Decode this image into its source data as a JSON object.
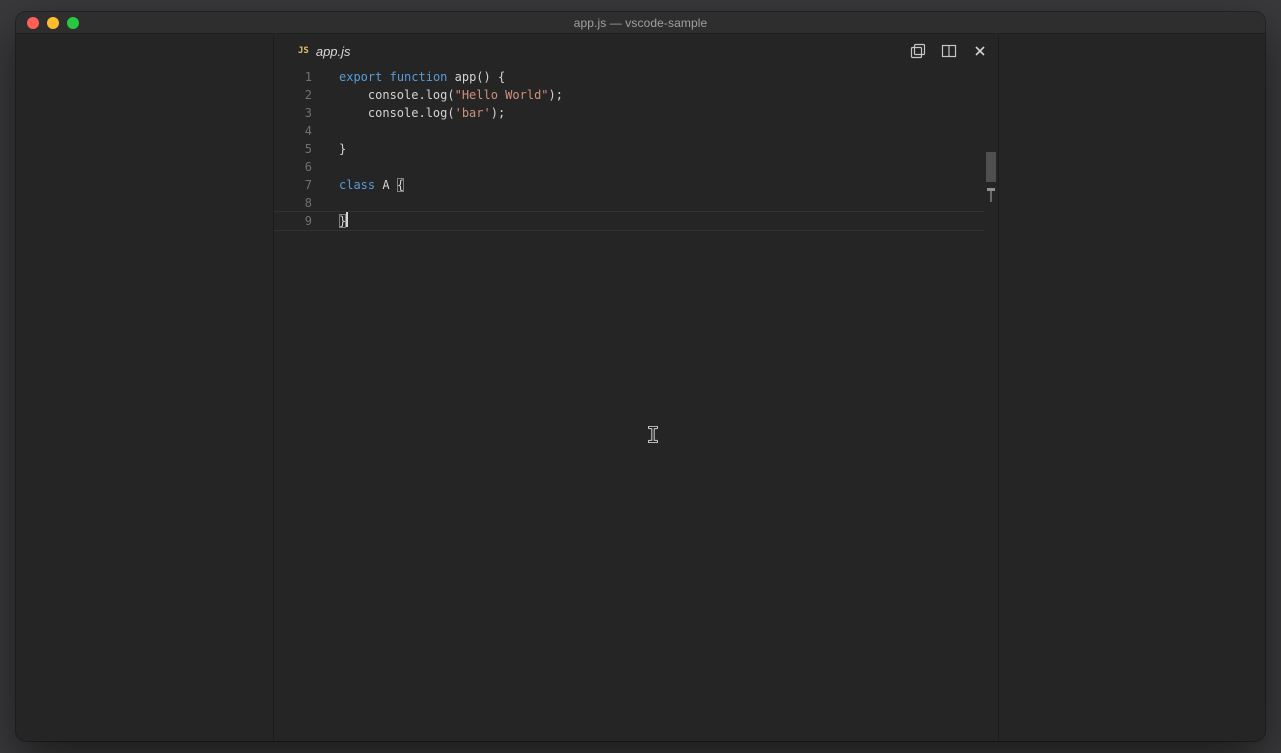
{
  "window": {
    "title": "app.js — vscode-sample"
  },
  "titlebar": {
    "buttons": [
      "close-window",
      "minimize-window",
      "zoom-window"
    ]
  },
  "tab": {
    "file_type_badge": "JS",
    "label": "app.js",
    "is_preview_italic": true
  },
  "editor_actions": [
    {
      "name": "open-changes-icon"
    },
    {
      "name": "split-editor-icon"
    },
    {
      "name": "close-editor-icon"
    }
  ],
  "code": {
    "language": "javascript",
    "lines": [
      {
        "number": "1",
        "segments": [
          {
            "t": "export",
            "c": "kw"
          },
          {
            "t": " ",
            "c": "pl"
          },
          {
            "t": "function",
            "c": "kw"
          },
          {
            "t": " app() {",
            "c": "pl"
          }
        ]
      },
      {
        "number": "2",
        "segments": [
          {
            "t": "    console.log(",
            "c": "pl"
          },
          {
            "t": "\"Hello World\"",
            "c": "str"
          },
          {
            "t": ");",
            "c": "pl"
          }
        ]
      },
      {
        "number": "3",
        "segments": [
          {
            "t": "    console.log(",
            "c": "pl"
          },
          {
            "t": "'bar'",
            "c": "str"
          },
          {
            "t": ");",
            "c": "pl"
          }
        ]
      },
      {
        "number": "4",
        "segments": []
      },
      {
        "number": "5",
        "segments": [
          {
            "t": "}",
            "c": "pl"
          }
        ]
      },
      {
        "number": "6",
        "segments": []
      },
      {
        "number": "7",
        "segments": [
          {
            "t": "class",
            "c": "kw"
          },
          {
            "t": " A ",
            "c": "pl"
          },
          {
            "t": "{",
            "c": "pl",
            "match": true
          }
        ]
      },
      {
        "number": "8",
        "segments": []
      },
      {
        "number": "9",
        "segments": [
          {
            "t": "}",
            "c": "pl",
            "match": true
          }
        ],
        "current": true,
        "caret": true
      }
    ]
  },
  "colors": {
    "kw": "#569cd6",
    "str": "#ce9178",
    "pl": "#d4d4d4",
    "lineno": "#6e7075",
    "js-badge": "#e3c06a",
    "desktop": "#3a3a3c",
    "window-bg": "#252526",
    "titlebar-bg": "#2e2e2e",
    "tl-red": "#ff5f57",
    "tl-yellow": "#febc2e",
    "tl-green": "#28c840"
  }
}
